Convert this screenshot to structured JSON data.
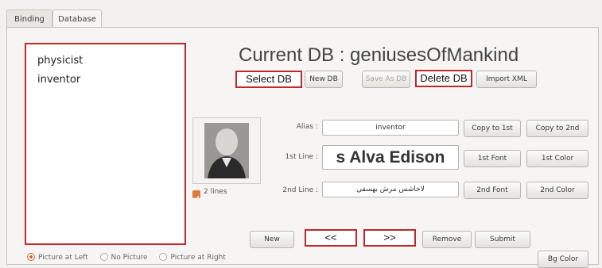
{
  "tabs": [
    {
      "label": "Binding"
    },
    {
      "label": "Database"
    }
  ],
  "db_list": [
    "physicist",
    "inventor"
  ],
  "title": "Current DB : geniusesOfMankind",
  "db_buttons": {
    "select_db": "Select DB",
    "new_db": "New DB",
    "save_as_db": "Save As DB",
    "delete_db": "Delete DB",
    "import_xml": "Import XML"
  },
  "form": {
    "alias_label": "Alias :",
    "alias_value": "inventor",
    "line1_label": "1st Line :",
    "line1_value": "s Alva Edison",
    "line2_label": "2nd Line :",
    "line2_value": "لاخاشس مرش بهسفي",
    "copy_1st": "Copy to 1st",
    "copy_2nd": "Copy to 2nd",
    "font_1st": "1st Font",
    "color_1st": "1st Color",
    "font_2nd": "2nd Font",
    "color_2nd": "2nd Color"
  },
  "two_lines": {
    "label": "2 lines",
    "checked": true
  },
  "nav_buttons": {
    "new": "New",
    "prev": "<<",
    "next": ">>",
    "remove": "Remove",
    "submit": "Submit"
  },
  "picture_position": {
    "options": [
      "Picture at Left",
      "No Picture",
      "Picture at Right"
    ],
    "selected": "Picture at Left"
  },
  "bg_color_button": "Bg Color",
  "colors": {
    "highlight_red": "#c0282c",
    "accent_orange": "#d2632c"
  }
}
